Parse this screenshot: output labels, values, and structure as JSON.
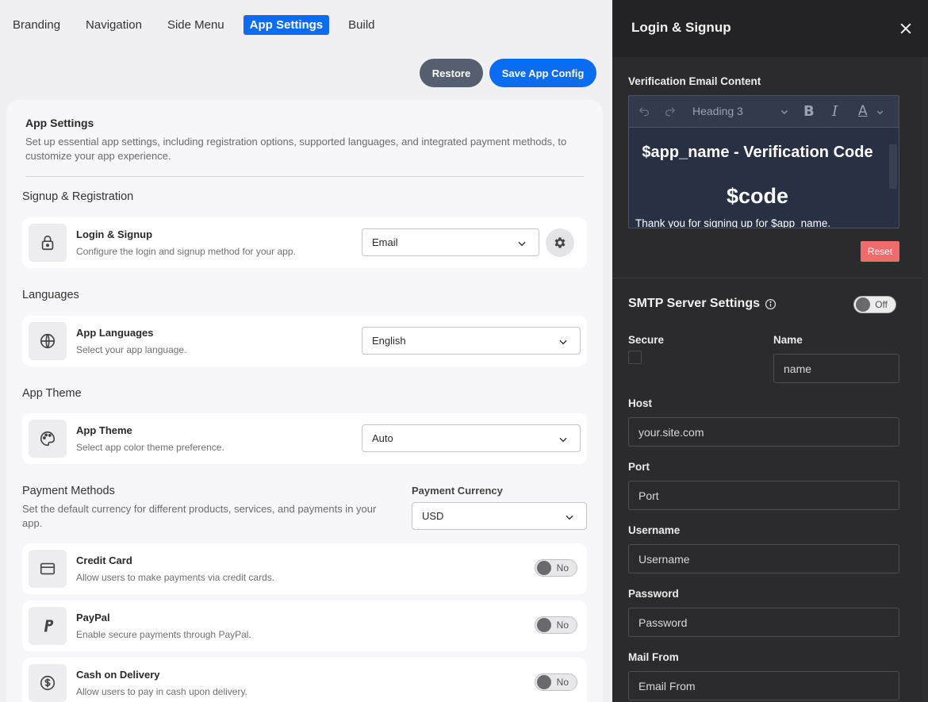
{
  "tabs": [
    "Branding",
    "Navigation",
    "Side Menu",
    "App Settings",
    "Build"
  ],
  "active_tab": "App Settings",
  "actions": {
    "restore": "Restore",
    "save": "Save App Config"
  },
  "settings": {
    "title": "App Settings",
    "description": "Set up essential app settings, including registration options, supported languages, and integrated payment methods, to customize your app experience."
  },
  "signup": {
    "heading": "Signup & Registration",
    "title": "Login & Signup",
    "desc": "Configure the login and signup method for your app.",
    "value": "Email"
  },
  "languages": {
    "heading": "Languages",
    "title": "App Languages",
    "desc": "Select your app language.",
    "value": "English"
  },
  "theme": {
    "heading": "App Theme",
    "title": "App Theme",
    "desc": "Select app color theme preference.",
    "value": "Auto"
  },
  "payment": {
    "heading": "Payment Methods",
    "desc": "Set the default currency for different products, services, and payments in your app.",
    "currency_label": "Payment Currency",
    "currency": "USD",
    "methods": [
      {
        "title": "Credit Card",
        "desc": "Allow users to make payments via credit cards.",
        "state": "No"
      },
      {
        "title": "PayPal",
        "desc": "Enable secure payments through PayPal.",
        "state": "No"
      },
      {
        "title": "Cash on Delivery",
        "desc": "Allow users to pay in cash upon delivery.",
        "state": "No"
      }
    ]
  },
  "drawer": {
    "title": "Login & Signup",
    "email_label": "Verification Email Content",
    "toolbar_style": "Heading 3",
    "email_heading": "$app_name - Verification Code",
    "email_code": "$code",
    "email_body": "Thank you for signing up for $app_name.",
    "reset": "Reset",
    "smtp_title": "SMTP Server Settings",
    "smtp_state": "Off",
    "secure_label": "Secure",
    "name_label": "Name",
    "name_value": "name",
    "host_label": "Host",
    "host_value": "your.site.com",
    "port_label": "Port",
    "port_value": "Port",
    "username_label": "Username",
    "username_value": "Username",
    "password_label": "Password",
    "password_value": "Password",
    "mailfrom_label": "Mail From",
    "mailfrom_value": "Email From"
  },
  "colors": {
    "accent": "#0a6cf0",
    "restore": "#555f70",
    "reset": "#f06b6b",
    "drawer_bg": "#2b2b2d"
  }
}
